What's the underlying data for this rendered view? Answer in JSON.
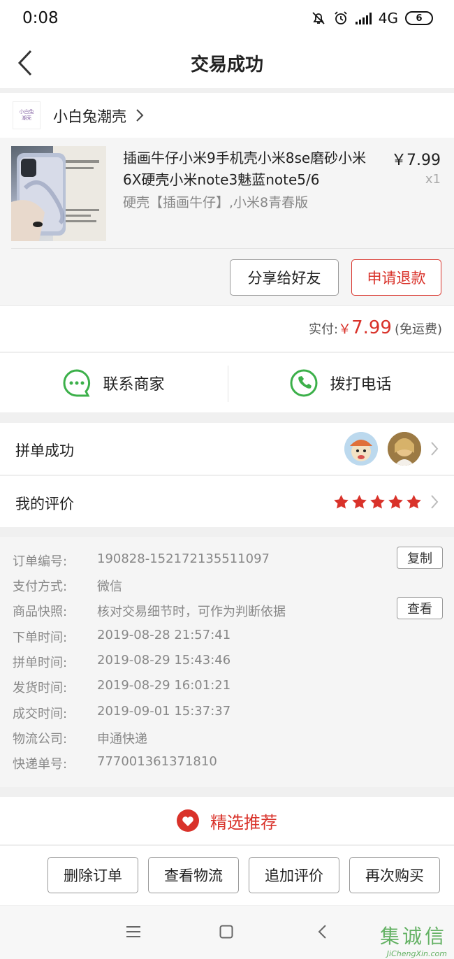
{
  "status": {
    "time": "0:08",
    "network": "4G",
    "battery": "6"
  },
  "header": {
    "title": "交易成功"
  },
  "shop": {
    "name": "小白兔潮壳",
    "logo_text_1": "小白兔",
    "logo_text_2": "潮壳"
  },
  "product": {
    "name": "插画牛仔小米9手机壳小米8se磨砂小米6X硬壳小米note3魅蓝note5/6",
    "spec": "硬壳【插画牛仔】,小米8青春版",
    "price": "￥7.99",
    "qty": "x1",
    "share_label": "分享给好友",
    "refund_label": "申请退款"
  },
  "total": {
    "label": "实付:",
    "currency": "￥",
    "amount": "7.99",
    "note": "(免运费)"
  },
  "contact": {
    "chat_label": "联系商家",
    "call_label": "拨打电话"
  },
  "group": {
    "label": "拼单成功"
  },
  "review": {
    "label": "我的评价",
    "stars": 5
  },
  "details": {
    "rows": [
      {
        "key": "订单编号:",
        "value": "190828-152172135511097"
      },
      {
        "key": "支付方式:",
        "value": "微信"
      },
      {
        "key": "商品快照:",
        "value": "核对交易细节时，可作为判断依据"
      },
      {
        "key": "下单时间:",
        "value": "2019-08-28 21:57:41"
      },
      {
        "key": "拼单时间:",
        "value": "2019-08-29 15:43:46"
      },
      {
        "key": "发货时间:",
        "value": "2019-08-29 16:01:21"
      },
      {
        "key": "成交时间:",
        "value": "2019-09-01 15:37:37"
      },
      {
        "key": "物流公司:",
        "value": "申通快递"
      },
      {
        "key": "快递单号:",
        "value": "777001361371810"
      }
    ],
    "copy_label": "复制",
    "view_label": "查看"
  },
  "recommend": {
    "label": "精选推荐"
  },
  "actions": {
    "delete_label": "删除订单",
    "logistics_label": "查看物流",
    "add_review_label": "追加评价",
    "rebuy_label": "再次购买"
  },
  "watermark": {
    "big": "集诚信",
    "small": "JiChengXin.com"
  },
  "colors": {
    "accent_red": "#d9322a",
    "green": "#3cb04a"
  }
}
